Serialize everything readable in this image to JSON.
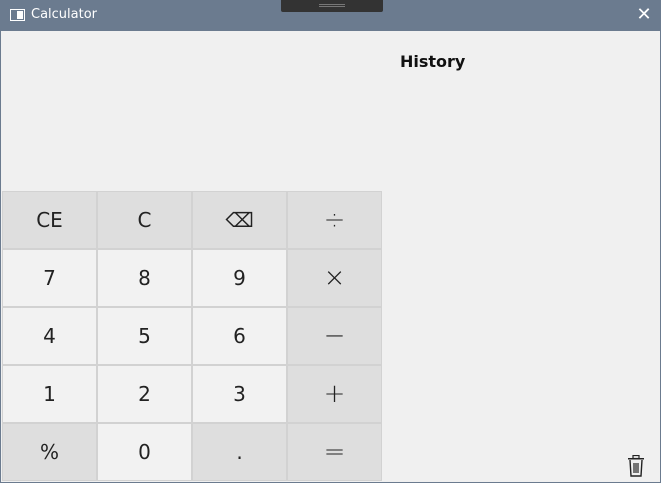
{
  "window": {
    "title": "Calculator"
  },
  "history": {
    "title": "History"
  },
  "keys": [
    {
      "id": "ce",
      "label": "CE",
      "kind": "func"
    },
    {
      "id": "c",
      "label": "C",
      "kind": "func"
    },
    {
      "id": "backspace",
      "label": "⌫",
      "kind": "func"
    },
    {
      "id": "divide",
      "label": "÷",
      "kind": "op"
    },
    {
      "id": "7",
      "label": "7",
      "kind": "num"
    },
    {
      "id": "8",
      "label": "8",
      "kind": "num"
    },
    {
      "id": "9",
      "label": "9",
      "kind": "num"
    },
    {
      "id": "multiply",
      "label": "×",
      "kind": "op"
    },
    {
      "id": "4",
      "label": "4",
      "kind": "num"
    },
    {
      "id": "5",
      "label": "5",
      "kind": "num"
    },
    {
      "id": "6",
      "label": "6",
      "kind": "num"
    },
    {
      "id": "subtract",
      "label": "−",
      "kind": "op"
    },
    {
      "id": "1",
      "label": "1",
      "kind": "num"
    },
    {
      "id": "2",
      "label": "2",
      "kind": "num"
    },
    {
      "id": "3",
      "label": "3",
      "kind": "num"
    },
    {
      "id": "add",
      "label": "+",
      "kind": "op"
    },
    {
      "id": "percent",
      "label": "%",
      "kind": "func"
    },
    {
      "id": "0",
      "label": "0",
      "kind": "num"
    },
    {
      "id": "decimal",
      "label": ".",
      "kind": "func"
    },
    {
      "id": "equals",
      "label": "=",
      "kind": "op"
    }
  ],
  "colors": {
    "titlebar": "#6b7b8f",
    "num_key": "#f2f2f2",
    "func_key": "#dedede",
    "background": "#f0f0f0"
  },
  "icons": {
    "close": "close-icon",
    "trash": "trash-icon",
    "app": "calculator-app-icon"
  }
}
